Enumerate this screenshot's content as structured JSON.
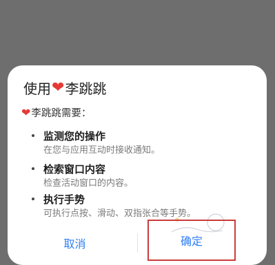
{
  "dialog": {
    "title_prefix": "使用",
    "app_name": "李跳跳",
    "heart_color": "#e53935",
    "needs_text": "李跳跳需要：",
    "permissions": [
      {
        "name": "监测您的操作",
        "desc": "在您与应用互动时接收通知。"
      },
      {
        "name": "检索窗口内容",
        "desc": "检查活动窗口的内容。"
      },
      {
        "name": "执行手势",
        "desc": "可执行点按、滑动、双指张合等手势。"
      }
    ],
    "cancel_label": "取消",
    "confirm_label": "确定",
    "button_color": "#2e7df6",
    "highlight_color": "#cc3a3a"
  }
}
